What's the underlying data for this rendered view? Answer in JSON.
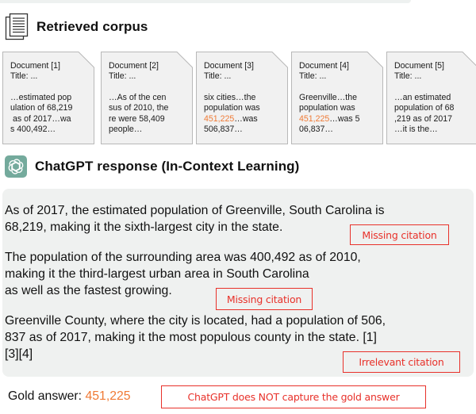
{
  "corpus": {
    "title": "Retrieved corpus",
    "icon": "document-stack-icon",
    "documents": [
      {
        "heading": "Document [1]",
        "title": "Title: ...",
        "lines": [
          "…estimated pop",
          "ulation of 68,219",
          " as of 2017…wa",
          "s 400,492…"
        ],
        "highlight": null
      },
      {
        "heading": "Document [2]",
        "title": "Title: ...",
        "lines": [
          "…As of the cen",
          "sus of 2010, the",
          "re were 58,409",
          "people…"
        ],
        "highlight": null
      },
      {
        "heading": "Document [3]",
        "title": "Title: ...",
        "line1": "six cities…the",
        "line2": "population was",
        "line3_highlight": "451,225",
        "line3_rest": "…was",
        "line4": "506,837…"
      },
      {
        "heading": "Document [4]",
        "title": "Title: ...",
        "line1": "Greenville…the",
        "line2": "population was",
        "line3_highlight": "451,225",
        "line3_rest": "…was 5",
        "line4": "06,837…"
      },
      {
        "heading": "Document [5]",
        "title": "Title: ...",
        "lines": [
          "…an estimated",
          "population of 68",
          ",219 as of 2017",
          "…it is the…"
        ],
        "highlight": null
      }
    ]
  },
  "response": {
    "title": "ChatGPT response (In-Context Learning)",
    "icon": "openai-logo-icon",
    "paragraphs": [
      {
        "line1": "As of 2017, the estimated population of Greenville, South Carolina is",
        "line2": "68,219, making it the sixth-largest city in the state."
      },
      {
        "line1": "The population of the surrounding area was 400,492 as of 2010,",
        "line2": "making it the third-largest urban area in South Carolina",
        "line3": "as well as the fastest growing."
      },
      {
        "line1": "Greenville County, where the city is located, had a population of 506,",
        "line2": "837 as of 2017, making it the most populous county in the state. [1]",
        "line3": "[3][4]"
      }
    ],
    "annotations": [
      "Missing citation",
      "Missing citation",
      "Irrelevant citation"
    ]
  },
  "gold": {
    "label": "Gold answer:",
    "value": "451,225",
    "annotation": "ChatGPT does NOT capture the gold answer"
  },
  "colors": {
    "highlight": "#f07a35",
    "annotation": "#e8312a",
    "gpt_icon_bg": "#74aa9c",
    "response_bg": "#eff1f0",
    "card_bg": "#f1f1f1"
  }
}
